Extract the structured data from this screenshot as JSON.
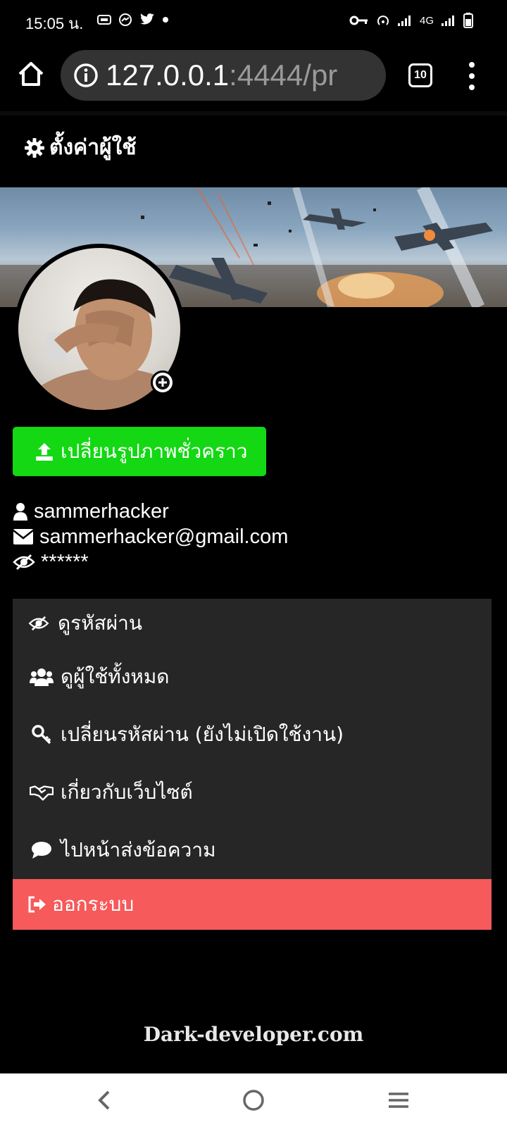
{
  "status": {
    "time": "15:05 น.",
    "network": "4G"
  },
  "browser": {
    "url_host": "127.0.0.1",
    "url_rest": ":4444/pr",
    "tab_count": "10"
  },
  "page": {
    "title": "ตั้งค่าผู้ใช้"
  },
  "profile": {
    "upload_label": "เปลี่ยนรูปภาพชั่วคราว",
    "username": "sammerhacker",
    "email": "sammerhacker@gmail.com",
    "password_mask": "******"
  },
  "menu": {
    "items": [
      {
        "label": "ดูรหัสผ่าน",
        "icon": "eye-slash-icon"
      },
      {
        "label": "ดูผู้ใช้ทั้งหมด",
        "icon": "users-icon"
      },
      {
        "label": "เปลี่ยนรหัสผ่าน (ยังไม่เปิดใช้งาน)",
        "icon": "key-icon"
      },
      {
        "label": "เกี่ยวกับเว็บไซต์",
        "icon": "handshake-icon"
      },
      {
        "label": "ไปหน้าส่งข้อความ",
        "icon": "comment-icon"
      }
    ],
    "logout_label": "ออกระบบ"
  },
  "footer": {
    "text": "Dark-developer.com"
  },
  "colors": {
    "upload_button": "#13d813",
    "logout_button": "#f65a5a",
    "menu_background": "#262626"
  }
}
